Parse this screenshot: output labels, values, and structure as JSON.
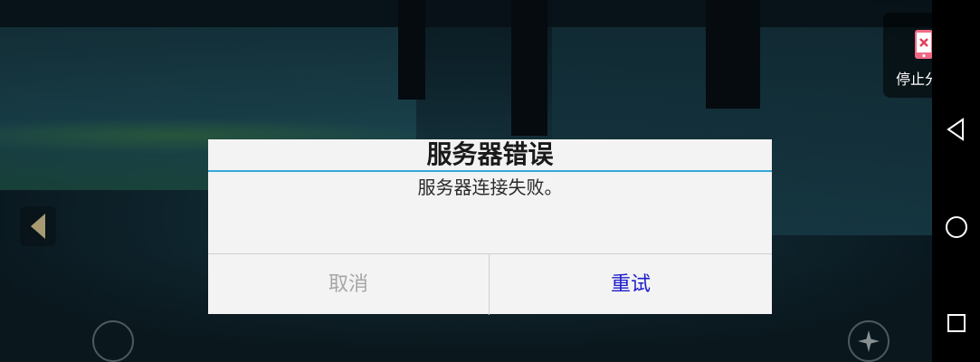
{
  "dialog": {
    "title": "服务器错误",
    "message": "服务器连接失败。",
    "cancel_label": "取消",
    "retry_label": "重试"
  },
  "stop_share": {
    "label": "停止分享",
    "icon": "phone-stop-icon"
  },
  "navbar": {
    "back_icon": "back-triangle-icon",
    "home_icon": "home-circle-icon",
    "recents_icon": "recents-square-icon"
  },
  "hud": {
    "left_arrow_icon": "left-arrow-icon",
    "right_arrow_icon": "right-arrow-icon",
    "action_circle_icon": "circle-button-icon",
    "compass_icon": "compass-star-icon"
  },
  "colors": {
    "accent_divider": "#36a7d9",
    "retry_text": "#1d1dcc",
    "cancel_text": "#a6a6a6",
    "dialog_bg": "#f3f3f3"
  }
}
